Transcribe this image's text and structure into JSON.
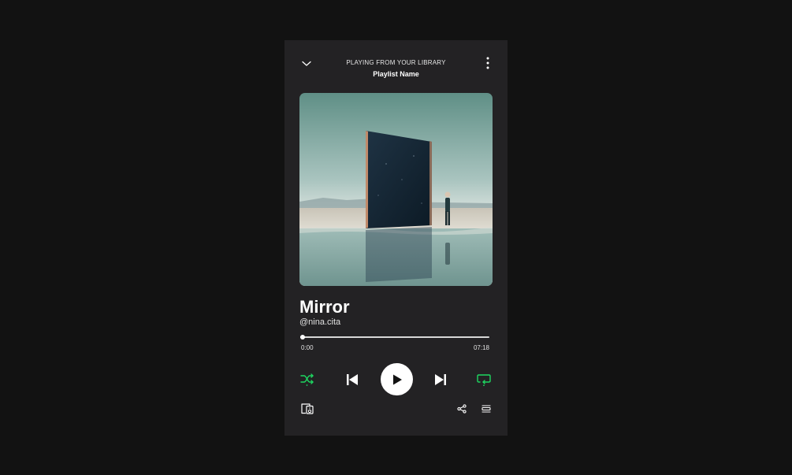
{
  "header": {
    "context_label": "PLAYING FROM YOUR LIBRARY",
    "playlist_name": "Playlist Name",
    "collapse_icon": "chevron-down-icon",
    "more_icon": "more-vertical-icon"
  },
  "track": {
    "title": "Mirror",
    "artist": "@nina.cita"
  },
  "progress": {
    "elapsed": "0:00",
    "total": "07:18",
    "fraction": 0.0
  },
  "controls": {
    "shuffle_icon": "shuffle-icon",
    "previous_icon": "skip-previous-icon",
    "play_icon": "play-icon",
    "next_icon": "skip-next-icon",
    "repeat_icon": "repeat-icon",
    "devices_icon": "connect-devices-icon",
    "share_icon": "share-icon",
    "queue_icon": "queue-icon"
  },
  "colors": {
    "background": "#121212",
    "panel": "#232224",
    "accent": "#1ed760",
    "text": "#ffffff"
  }
}
